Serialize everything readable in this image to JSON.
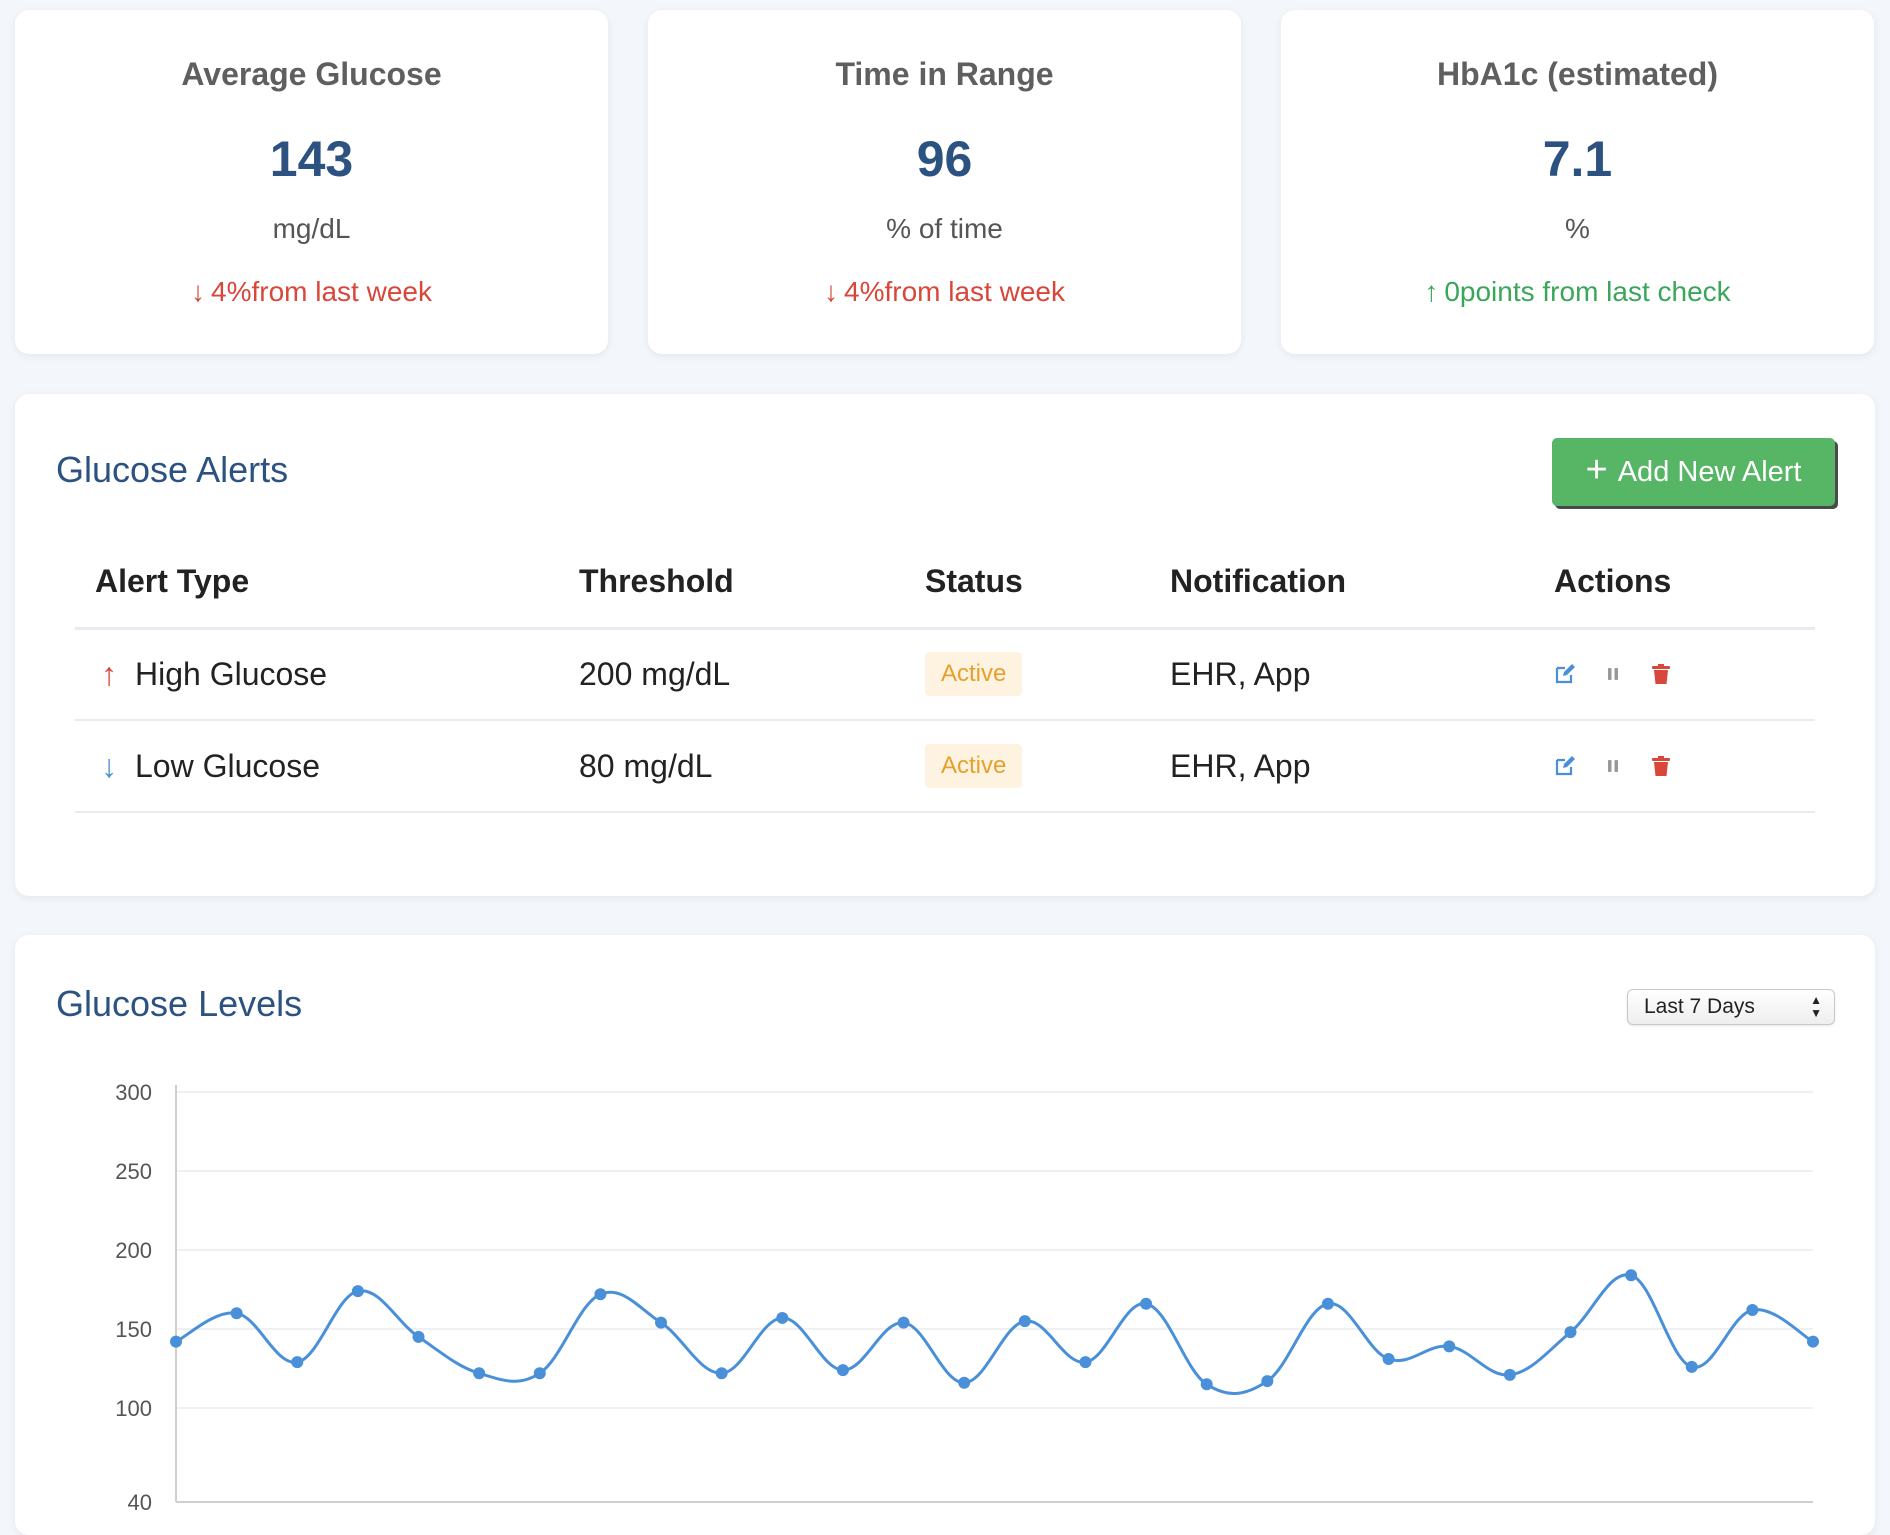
{
  "stats": [
    {
      "label": "Average Glucose",
      "value": "143",
      "unit": "mg/dL",
      "change_arrow": "↓",
      "change_text": "4%from last week",
      "direction": "down"
    },
    {
      "label": "Time in Range",
      "value": "96",
      "unit": "% of time",
      "change_arrow": "↓",
      "change_text": "4%from last week",
      "direction": "down"
    },
    {
      "label": "HbA1c (estimated)",
      "value": "7.1",
      "unit": "%",
      "change_arrow": "↑",
      "change_text": "0points from last check",
      "direction": "up"
    }
  ],
  "alerts": {
    "title": "Glucose Alerts",
    "add_button_label": "Add New Alert",
    "columns": [
      "Alert Type",
      "Threshold",
      "Status",
      "Notification",
      "Actions"
    ],
    "rows": [
      {
        "arrow": "↑",
        "direction": "up",
        "type": "High Glucose",
        "threshold": "200 mg/dL",
        "status": "Active",
        "notification": "EHR, App"
      },
      {
        "arrow": "↓",
        "direction": "down",
        "type": "Low Glucose",
        "threshold": "80 mg/dL",
        "status": "Active",
        "notification": "EHR, App"
      }
    ],
    "icons": {
      "edit": "edit-icon",
      "pause": "pause-icon",
      "delete": "trash-icon"
    },
    "colors": {
      "edit": "#4a90d9",
      "pause": "#999999",
      "delete": "#d9463a"
    }
  },
  "levels": {
    "title": "Glucose Levels",
    "range_selected": "Last 7 Days"
  },
  "chart_data": {
    "type": "line",
    "title": "",
    "xlabel": "",
    "ylabel": "",
    "y_ticks": [
      40,
      100,
      150,
      200,
      250,
      300
    ],
    "ylim": [
      40,
      300
    ],
    "grid": true,
    "color": "#4a90d9",
    "series": [
      {
        "values": [
          142,
          160,
          129,
          174,
          145,
          122,
          122,
          172,
          154,
          122,
          157,
          124,
          154,
          116,
          155,
          129,
          166,
          115,
          117,
          166,
          131,
          139,
          121,
          148,
          184,
          126,
          162,
          142
        ]
      }
    ]
  }
}
